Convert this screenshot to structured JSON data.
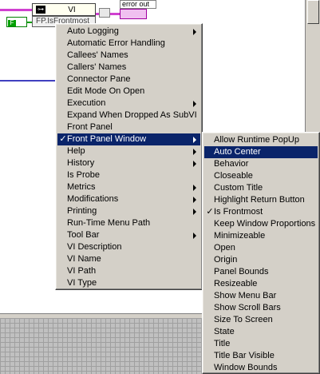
{
  "diagram": {
    "vi_label": "VI",
    "property_label": "FP.IsFrontmost",
    "constant_label": "F",
    "error_out_label": "error out"
  },
  "context_menu": {
    "items": [
      {
        "label": "Auto Logging",
        "submenu": true
      },
      {
        "label": "Automatic Error Handling",
        "submenu": false
      },
      {
        "label": "Callees' Names",
        "submenu": false
      },
      {
        "label": "Callers' Names",
        "submenu": false
      },
      {
        "label": "Connector Pane",
        "submenu": false
      },
      {
        "label": "Edit Mode On Open",
        "submenu": false
      },
      {
        "label": "Execution",
        "submenu": true
      },
      {
        "label": "Expand When Dropped As SubVI",
        "submenu": false
      },
      {
        "label": "Front Panel",
        "submenu": false
      },
      {
        "label": "Front Panel Window",
        "submenu": true,
        "checked": true,
        "highlighted": true
      },
      {
        "label": "Help",
        "submenu": true
      },
      {
        "label": "History",
        "submenu": true
      },
      {
        "label": "Is Probe",
        "submenu": false
      },
      {
        "label": "Metrics",
        "submenu": true
      },
      {
        "label": "Modifications",
        "submenu": true
      },
      {
        "label": "Printing",
        "submenu": true
      },
      {
        "label": "Run-Time Menu Path",
        "submenu": false
      },
      {
        "label": "Tool Bar",
        "submenu": true
      },
      {
        "label": "VI Description",
        "submenu": false
      },
      {
        "label": "VI Name",
        "submenu": false
      },
      {
        "label": "VI Path",
        "submenu": false
      },
      {
        "label": "VI Type",
        "submenu": false
      }
    ]
  },
  "submenu": {
    "items": [
      {
        "label": "Allow Runtime PopUp"
      },
      {
        "label": "Auto Center",
        "highlighted": true
      },
      {
        "label": "Behavior"
      },
      {
        "label": "Closeable"
      },
      {
        "label": "Custom Title"
      },
      {
        "label": "Highlight Return Button"
      },
      {
        "label": "Is Frontmost",
        "checked": true
      },
      {
        "label": "Keep Window Proportions"
      },
      {
        "label": "Minimizeable"
      },
      {
        "label": "Open"
      },
      {
        "label": "Origin"
      },
      {
        "label": "Panel Bounds"
      },
      {
        "label": "Resizeable"
      },
      {
        "label": "Show Menu Bar"
      },
      {
        "label": "Show Scroll Bars"
      },
      {
        "label": "Size To Screen"
      },
      {
        "label": "State"
      },
      {
        "label": "Title"
      },
      {
        "label": "Title Bar Visible"
      },
      {
        "label": "Window Bounds"
      }
    ]
  },
  "check_glyph": "✓",
  "colors": {
    "highlight": "#0a246a",
    "menu_bg": "#d4d0c8"
  }
}
